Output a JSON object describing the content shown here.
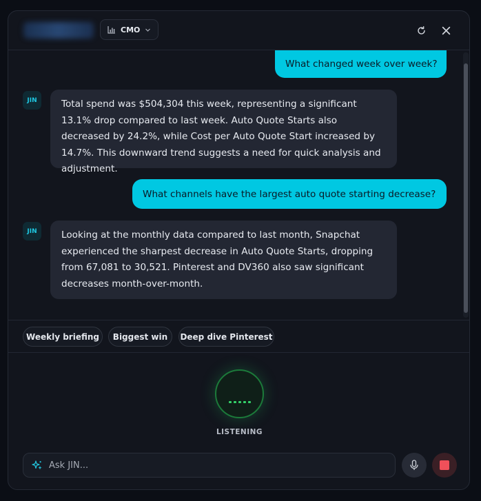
{
  "header": {
    "role_label": "CMO",
    "icons": [
      "bar-chart-icon",
      "chevron-down-icon",
      "refresh-icon",
      "close-icon"
    ]
  },
  "messages": [
    {
      "from": "user",
      "text": "What changed week over week?"
    },
    {
      "from": "bot",
      "avatar": "JIN",
      "text": "Total spend was $504,304 this week, representing a significant 13.1% drop compared to last week. Auto Quote Starts also decreased by 24.2%, while Cost per Auto Quote Start increased by 14.7%. This downward trend suggests a need for quick analysis and adjustment."
    },
    {
      "from": "user",
      "text": "What channels have the largest auto quote starting decrease?"
    },
    {
      "from": "bot",
      "avatar": "JIN",
      "text": "Looking at the monthly data compared to last month, Snapchat experienced the sharpest decrease in Auto Quote Starts, dropping from 67,081 to 30,521. Pinterest and DV360 also saw significant decreases month-over-month."
    }
  ],
  "suggestions": [
    "Weekly briefing",
    "Biggest win",
    "Deep dive Pinterest"
  ],
  "voice": {
    "status": "LISTENING"
  },
  "input": {
    "placeholder": "Ask JIN...",
    "value": ""
  },
  "colors": {
    "accent": "#00c8e2",
    "listening_green": "#34d36a",
    "stop_red": "#f0505a",
    "panel_bg": "#12151d",
    "bot_bubble": "#232733"
  }
}
